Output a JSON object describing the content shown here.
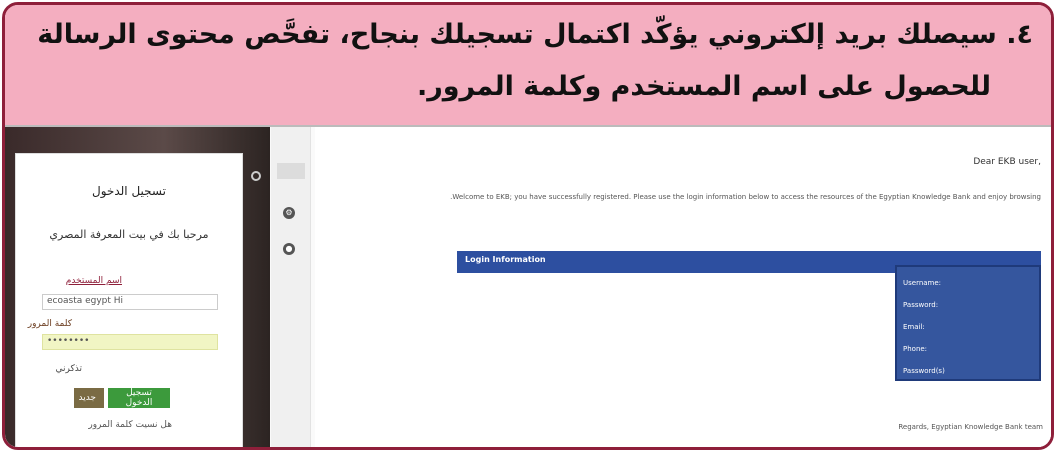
{
  "banner": {
    "line1": "٤. سيصلك بريد إلكتروني يؤكّد اكتمال تسجيلك بنجاح، تفحَّص محتوى الرسالة",
    "line2": "للحصول على اسم المستخدم وكلمة المرور."
  },
  "login_panel": {
    "title": "تسجيل الدخول",
    "subtitle": "مرحبا بك في بيت المعرفة المصري",
    "username_label": "اسم المستخدم",
    "username_value": "ecoasta egypt Hi",
    "password_label": "كلمة المرور",
    "password_value": "••••••••",
    "remember_label": "تذكرني",
    "login_button": "تسجيل الدخول",
    "new_button": "جديد",
    "forgot_link": "هل نسيت كلمة المرور"
  },
  "email": {
    "greeting": "Dear EKB user,",
    "paragraph": "Welcome to EKB; you have successfully registered. Please use the login information below to access the resources of the Egyptian Knowledge Bank and enjoy browsing.",
    "login_header": "Login Information",
    "cred_lines": [
      "Username:",
      "Password:",
      "Email:",
      "Phone:",
      "Password(s)"
    ],
    "footer": "Regards, Egyptian Knowledge Bank team"
  },
  "colors": {
    "banner_bg": "#f4aec0",
    "frame_border": "#8e1f3a",
    "login_green": "#3c9a3c",
    "email_blue": "#2d4fa0"
  }
}
